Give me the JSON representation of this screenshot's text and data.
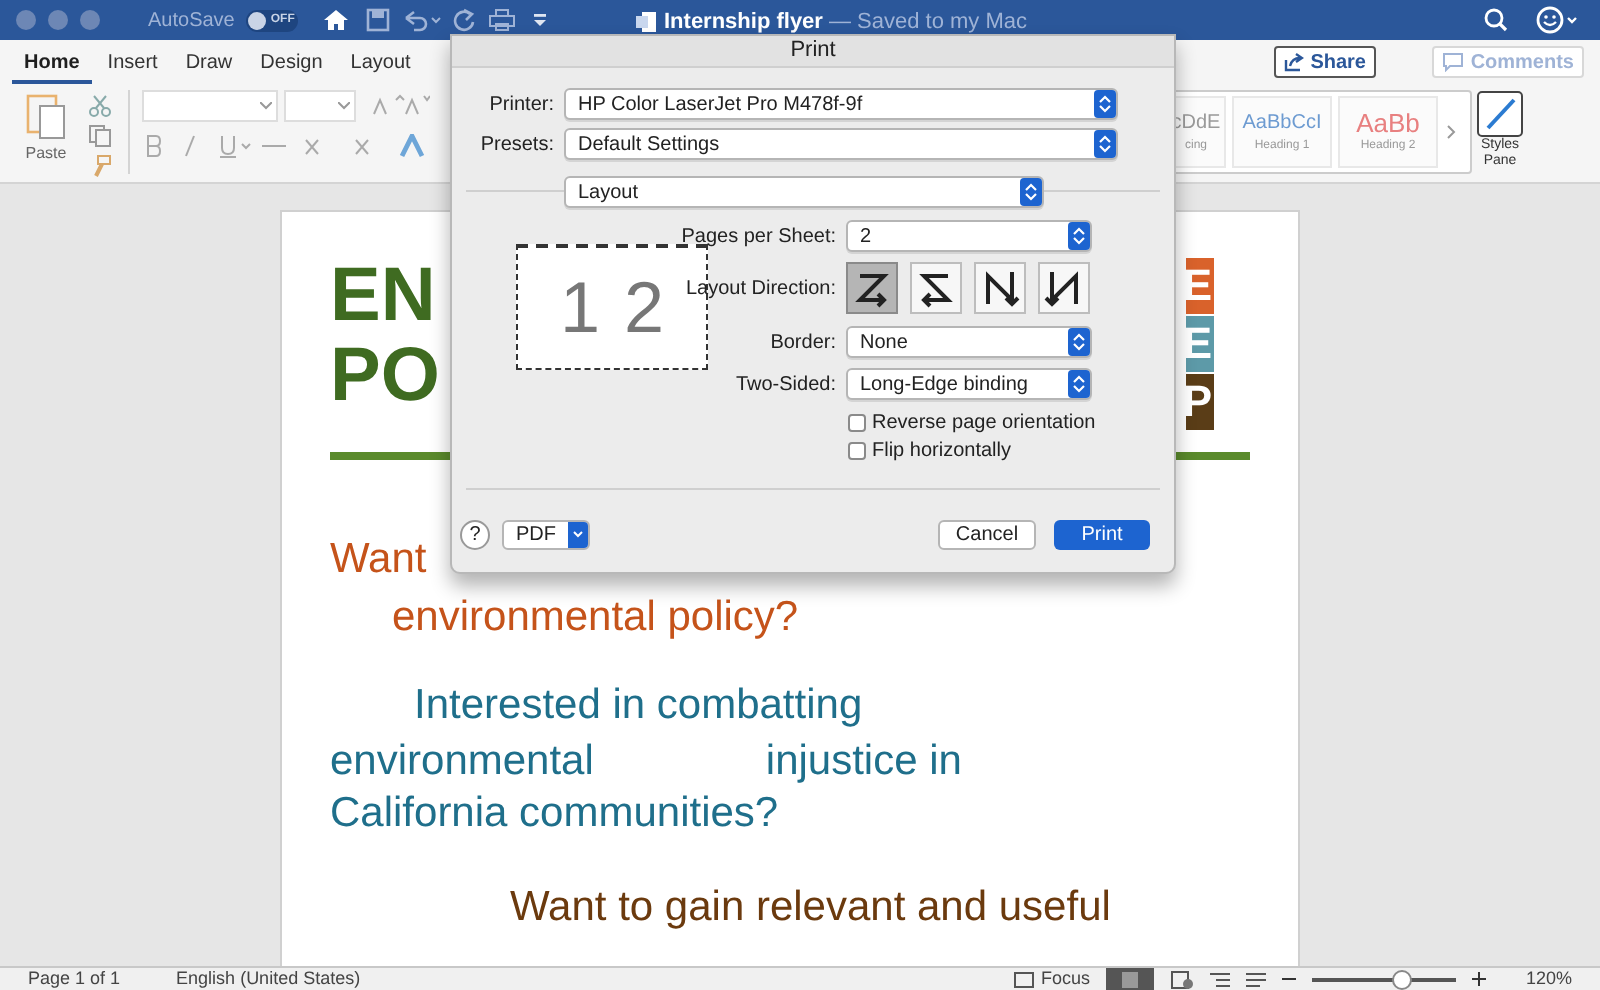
{
  "title_bar": {
    "autosave": {
      "label": "AutoSave",
      "on": false,
      "state_label": "OFF"
    },
    "document_title": "Internship flyer",
    "save_status": "— Saved to my Mac"
  },
  "ribbon_tabs": [
    {
      "label": "Home",
      "selected": true
    },
    {
      "label": "Insert",
      "selected": false
    },
    {
      "label": "Draw",
      "selected": false
    },
    {
      "label": "Design",
      "selected": false
    },
    {
      "label": "Layout",
      "selected": false
    }
  ],
  "share": "Share",
  "comments": "Comments",
  "ribbon": {
    "paste_label": "Paste",
    "styles": [
      {
        "preview": "cDdE",
        "name": "cing",
        "color": "#9a9a9a"
      },
      {
        "preview": "AaBbCcI",
        "name": "Heading 1",
        "color": "#6d9bd1"
      },
      {
        "preview": "AaBb",
        "name": "Heading 2",
        "color": "#e88080"
      }
    ],
    "styles_pane": "Styles Pane"
  },
  "document": {
    "title_lines": [
      "EN",
      "PO"
    ],
    "tiles": [
      {
        "letter": "E",
        "color": "#d9622b"
      },
      {
        "letter": "E",
        "color": "#5d9aa8"
      },
      {
        "letter": "P",
        "color": "#5a3d17"
      }
    ],
    "paragraphs": [
      {
        "lines": [
          "Want"
        ],
        "color": "#c5531a"
      },
      {
        "lines": [
          "environmental policy?"
        ],
        "color": "#c5531a"
      },
      {
        "lines": [
          "Interested in combatting"
        ],
        "color": "#1f6f8b"
      },
      {
        "lines": [
          "environmental",
          "injustice in"
        ],
        "color": "#1f6f8b"
      },
      {
        "lines": [
          "California communities?"
        ],
        "color": "#1f6f8b"
      },
      {
        "lines": [
          "Want to gain relevant and useful"
        ],
        "color": "#6b3a0e"
      }
    ]
  },
  "print_dialog": {
    "title": "Print",
    "printer_label": "Printer:",
    "printer": "HP Color LaserJet Pro M478f-9f",
    "presets_label": "Presets:",
    "presets": "Default Settings",
    "section": "Layout",
    "preview_pages": [
      "1",
      "2"
    ],
    "pages_per_sheet_label": "Pages per Sheet:",
    "pages_per_sheet": "2",
    "layout_direction_label": "Layout Direction:",
    "layout_directions": [
      {
        "kind": "z",
        "selected": true
      },
      {
        "kind": "s",
        "selected": false
      },
      {
        "kind": "n-reverse",
        "selected": false
      },
      {
        "kind": "n",
        "selected": false
      }
    ],
    "border_label": "Border:",
    "border": "None",
    "two_sided_label": "Two-Sided:",
    "two_sided": "Long-Edge binding",
    "checkboxes": [
      {
        "label": "Reverse page orientation",
        "checked": false
      },
      {
        "label": "Flip horizontally",
        "checked": false
      }
    ],
    "help": "?",
    "pdf": "PDF",
    "cancel": "Cancel",
    "print": "Print"
  },
  "status_bar": {
    "page": "Page 1 of 1",
    "language": "English (United States)",
    "focus": "Focus",
    "zoom": {
      "level": 0.62
    },
    "zoom_percent": "120%"
  }
}
